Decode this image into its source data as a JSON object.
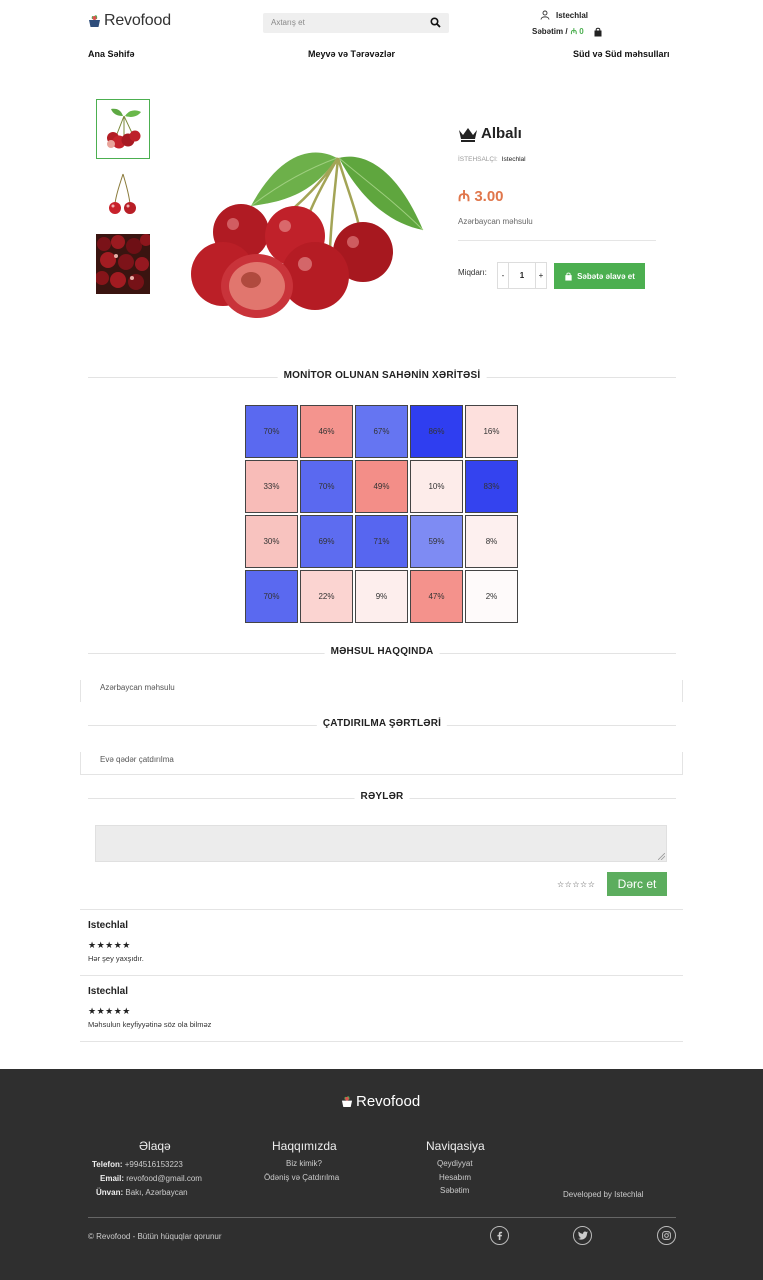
{
  "header": {
    "logo_text": "Revofood",
    "search_placeholder": "Axtarış et",
    "user_name": "Istechlal",
    "cart_label": "Səbətim /",
    "cart_amount": "₼ 0"
  },
  "nav": {
    "items": [
      "Ana Səhifə",
      "Meyvə və Tərəvəzlər",
      "Süd və Süd məhsulları"
    ]
  },
  "product": {
    "name": "Albalı",
    "maker_label": "İSTEHSALÇI:",
    "maker": "Istechlal",
    "price": "₼ 3.00",
    "origin": "Azərbaycan məhsulu",
    "quantity_label": "Miqdarı:",
    "qty_minus": "-",
    "qty_value": "1",
    "qty_plus": "+",
    "add_to_cart": "Səbətə əlavə et"
  },
  "heatmap": {
    "title": "MONİTOR OLUNAN SAHƏNİN XƏRİTƏSİ",
    "rows": [
      [
        {
          "v": "70%",
          "c": "#5a69f0"
        },
        {
          "v": "46%",
          "c": "#f4948e"
        },
        {
          "v": "67%",
          "c": "#6575f2"
        },
        {
          "v": "86%",
          "c": "#2f3ef0"
        },
        {
          "v": "16%",
          "c": "#fde0dd"
        }
      ],
      [
        {
          "v": "33%",
          "c": "#f8bcb8"
        },
        {
          "v": "70%",
          "c": "#5a69f0"
        },
        {
          "v": "49%",
          "c": "#f38e88"
        },
        {
          "v": "10%",
          "c": "#fdecea"
        },
        {
          "v": "83%",
          "c": "#3443ef"
        }
      ],
      [
        {
          "v": "30%",
          "c": "#f8c3bf"
        },
        {
          "v": "69%",
          "c": "#5d6cf0"
        },
        {
          "v": "71%",
          "c": "#5766f0"
        },
        {
          "v": "59%",
          "c": "#7e8bf3"
        },
        {
          "v": "8%",
          "c": "#fdf0ef"
        }
      ],
      [
        {
          "v": "70%",
          "c": "#5a69f0"
        },
        {
          "v": "22%",
          "c": "#fbd4d1"
        },
        {
          "v": "9%",
          "c": "#fdeeed"
        },
        {
          "v": "47%",
          "c": "#f4928c"
        },
        {
          "v": "2%",
          "c": "#fefafa"
        }
      ]
    ]
  },
  "about": {
    "title": "MƏHSUL HAQQINDA",
    "text": "Azərbaycan məhsulu"
  },
  "delivery": {
    "title": "ÇATDIRILMA ŞƏRTLƏRİ",
    "text": "Evə qədər çatdırılma"
  },
  "reviews": {
    "title": "RƏYLƏR",
    "stars_input": "☆☆☆☆☆",
    "submit": "Dərc et",
    "items": [
      {
        "author": "Istechlal",
        "stars": "★★★★★",
        "text": "Hər şey yaxşıdır."
      },
      {
        "author": "Istechlal",
        "stars": "★★★★★",
        "text": "Məhsulun keyfiyyətinə söz ola bilməz"
      }
    ]
  },
  "footer": {
    "logo_text": "Revofood",
    "contact_title": "Əlaqə",
    "phone_label": "Telefon:",
    "phone": "+994516153223",
    "email_label": "Email:",
    "email": "revofood@gmail.com",
    "address_label": "Ünvan:",
    "address": "Bakı, Azərbaycan",
    "about_title": "Haqqımızda",
    "about_links": [
      "Biz kimik?",
      "Ödəniş və Çatdırılma"
    ],
    "nav_title": "Naviqasiya",
    "nav_links": [
      "Qeydiyyat",
      "Hesabım",
      "Səbətim"
    ],
    "developed": "Developed by Istechlal",
    "copyright": "© Revofood - Bütün hüquqlar qorunur"
  }
}
